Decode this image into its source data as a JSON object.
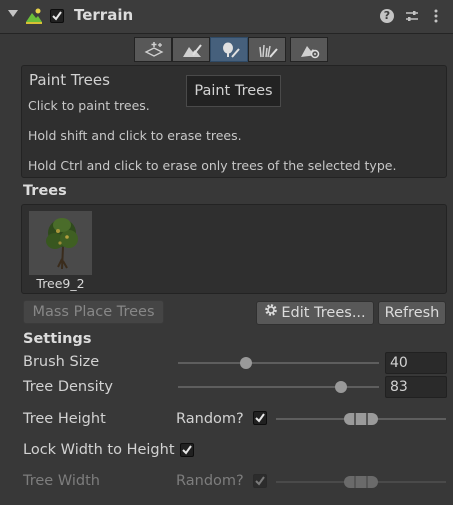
{
  "header": {
    "title": "Terrain",
    "enabled": true
  },
  "toolbar": {
    "active_tool": "paint-trees"
  },
  "help": {
    "title": "Paint Trees",
    "lines": [
      "Click to paint trees.",
      "Hold shift and click to erase trees.",
      "Hold Ctrl and click to erase only trees of the selected type."
    ],
    "paint_button": "Paint Trees"
  },
  "trees": {
    "section_title": "Trees",
    "items": [
      {
        "name": "Tree9_2"
      }
    ]
  },
  "actions": {
    "mass_place": "Mass Place Trees",
    "edit_trees": "Edit Trees...",
    "refresh": "Refresh"
  },
  "settings": {
    "section_title": "Settings",
    "brush_size": {
      "label": "Brush Size",
      "value": "40",
      "fraction": 0.33
    },
    "tree_density": {
      "label": "Tree Density",
      "value": "83",
      "fraction": 0.83
    },
    "tree_height": {
      "label": "Tree Height",
      "random_label": "Random?",
      "random": true
    },
    "lock_width": {
      "label": "Lock Width to Height",
      "checked": true
    },
    "tree_width": {
      "label": "Tree Width",
      "random_label": "Random?",
      "random": true
    }
  }
}
